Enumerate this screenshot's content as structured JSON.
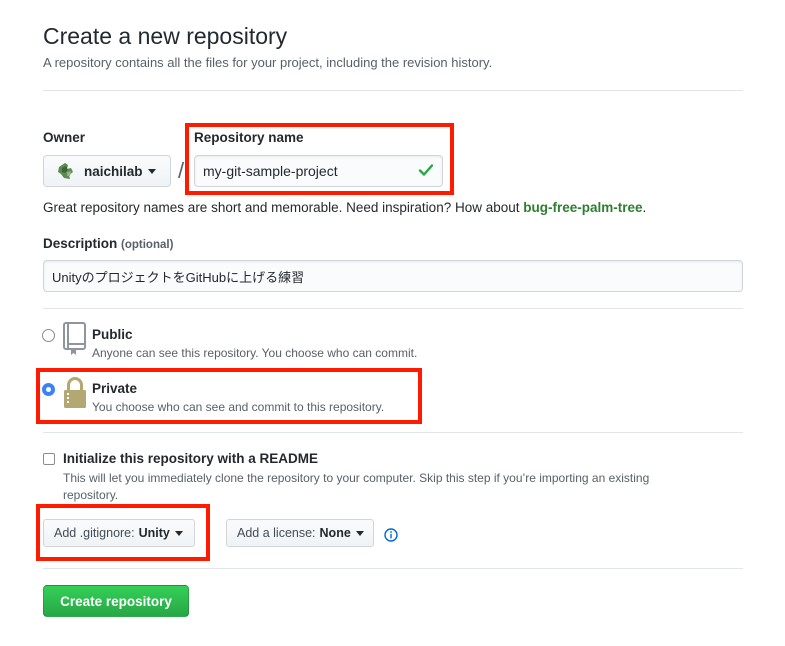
{
  "header": {
    "title": "Create a new repository",
    "subtitle": "A repository contains all the files for your project, including the revision history."
  },
  "owner": {
    "label": "Owner",
    "name": "naichilab",
    "avatar_icon": "owner-avatar-icon"
  },
  "separator": "/",
  "repository_name": {
    "label": "Repository name",
    "value": "my-git-sample-project",
    "valid_icon": "check-icon",
    "valid_color": "#28a745"
  },
  "name_hint": {
    "text": "Great repository names are short and memorable. Need inspiration? How about ",
    "suggestion": "bug-free-palm-tree",
    "end": "."
  },
  "description": {
    "label": "Description",
    "optional": "(optional)",
    "value": "UnityのプロジェクトをGitHubに上げる練習"
  },
  "visibility": {
    "public": {
      "title": "Public",
      "desc": "Anyone can see this repository. You choose who can commit.",
      "icon": "repo-book-icon",
      "selected": false
    },
    "private": {
      "title": "Private",
      "desc": "You choose who can see and commit to this repository.",
      "icon": "lock-icon",
      "selected": true
    }
  },
  "readme": {
    "title": "Initialize this repository with a README",
    "desc": "This will let you immediately clone the repository to your computer. Skip this step if you’re importing an existing repository.",
    "checked": false
  },
  "gitignore": {
    "label": "Add .gitignore:",
    "value": "Unity"
  },
  "license": {
    "label": "Add a license:",
    "value": "None",
    "info_icon": "info-icon"
  },
  "submit": {
    "label": "Create repository"
  },
  "colors": {
    "highlight": "#ff1a00",
    "primary_button": "#28a745",
    "suggestion": "#2f7d31",
    "radio_selected": "#3b82f6"
  }
}
